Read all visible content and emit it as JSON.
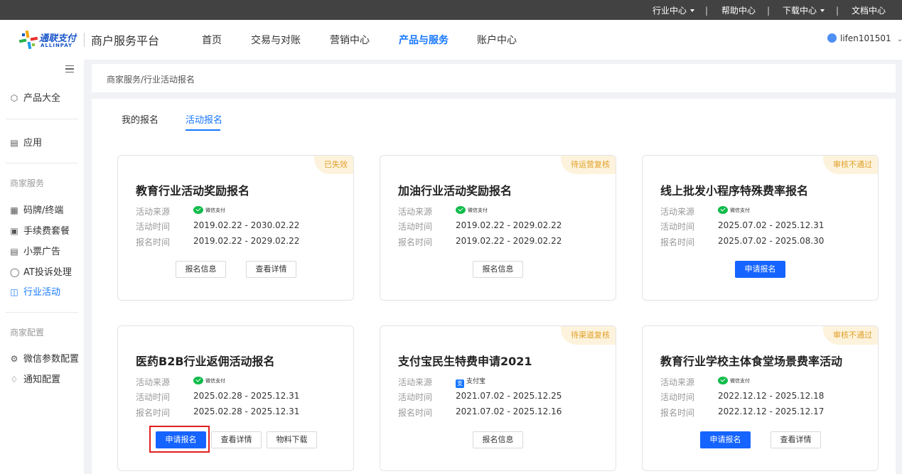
{
  "topbar": {
    "industry": "行业中心",
    "help": "帮助中心",
    "download": "下载中心",
    "docs": "文档中心",
    "separator": "|"
  },
  "header": {
    "logo_cn": "通联支付",
    "logo_en": "ALLINPAY",
    "platform": "商户服务平台",
    "nav": [
      "首页",
      "交易与对账",
      "营销中心",
      "产品与服务",
      "账户中心"
    ],
    "active_nav": "产品与服务",
    "username": "lifen101501"
  },
  "sidebar": {
    "top_items": [
      {
        "label": "产品大全",
        "icon": "cube-icon"
      },
      {
        "label": "应用",
        "icon": "box-icon"
      }
    ],
    "groups": [
      {
        "title": "商家服务",
        "items": [
          {
            "label": "码牌/终端",
            "icon": "terminal-icon"
          },
          {
            "label": "手续费套餐",
            "icon": "package-icon"
          },
          {
            "label": "小票广告",
            "icon": "receipt-icon"
          },
          {
            "label": "AT投诉处理",
            "icon": "shield-icon"
          },
          {
            "label": "行业活动",
            "icon": "cart-icon",
            "active": true
          }
        ]
      },
      {
        "title": "商家配置",
        "items": [
          {
            "label": "微信参数配置",
            "icon": "settings-icon"
          },
          {
            "label": "通知配置",
            "icon": "bell-icon"
          }
        ]
      }
    ]
  },
  "breadcrumb": "商家服务/行业活动报名",
  "tabs": [
    "我的报名",
    "活动报名"
  ],
  "active_tab": "活动报名",
  "labels": {
    "source": "活动来源",
    "activity_time": "活动时间",
    "signup_time": "报名时间"
  },
  "source_names": {
    "wechat": "微信支付",
    "alipay": "支付宝"
  },
  "cards": [
    {
      "title": "教育行业活动奖励报名",
      "badge": "已失效",
      "source": "wechat",
      "activity_time": "2019.02.22 - 2030.02.22",
      "signup_time": "2019.02.22 - 2029.02.22",
      "buttons": [
        "报名信息",
        "查看详情"
      ],
      "primary": []
    },
    {
      "title": "加油行业活动奖励报名",
      "badge": "待运营复核",
      "source": "wechat",
      "activity_time": "2019.02.22 - 2029.02.22",
      "signup_time": "2019.02.22 - 2029.02.22",
      "buttons": [
        "报名信息"
      ],
      "primary": []
    },
    {
      "title": "线上批发小程序特殊费率报名",
      "badge": "审核不通过",
      "source": "wechat",
      "activity_time": "2025.07.02 - 2025.12.31",
      "signup_time": "2025.07.02 - 2025.08.30",
      "buttons": [
        "申请报名"
      ],
      "primary": [
        "申请报名"
      ]
    },
    {
      "title": "医药B2B行业返佣活动报名",
      "badge": "",
      "source": "wechat",
      "activity_time": "2025.02.28 - 2025.12.31",
      "signup_time": "2025.02.28 - 2025.12.31",
      "buttons": [
        "申请报名",
        "查看详情",
        "物料下载"
      ],
      "primary": [
        "申请报名"
      ],
      "highlighted": true
    },
    {
      "title": "支付宝民生特费申请2021",
      "badge": "待渠道复核",
      "source": "alipay",
      "activity_time": "2021.07.02 - 2025.12.25",
      "signup_time": "2021.07.02 - 2025.12.16",
      "buttons": [
        "报名信息"
      ],
      "primary": []
    },
    {
      "title": "教育行业学校主体食堂场景费率活动",
      "badge": "审核不通过",
      "source": "wechat",
      "activity_time": "2022.12.12 - 2025.12.18",
      "signup_time": "2022.12.12 - 2025.12.17",
      "buttons": [
        "申请报名",
        "查看详情"
      ],
      "primary": [
        "申请报名"
      ]
    }
  ],
  "colors": {
    "primary": "#1664ff",
    "badge_text": "#e0a028",
    "badge_bg": "#fdf3dd",
    "highlight": "#e02020",
    "topbar": "#424242"
  }
}
